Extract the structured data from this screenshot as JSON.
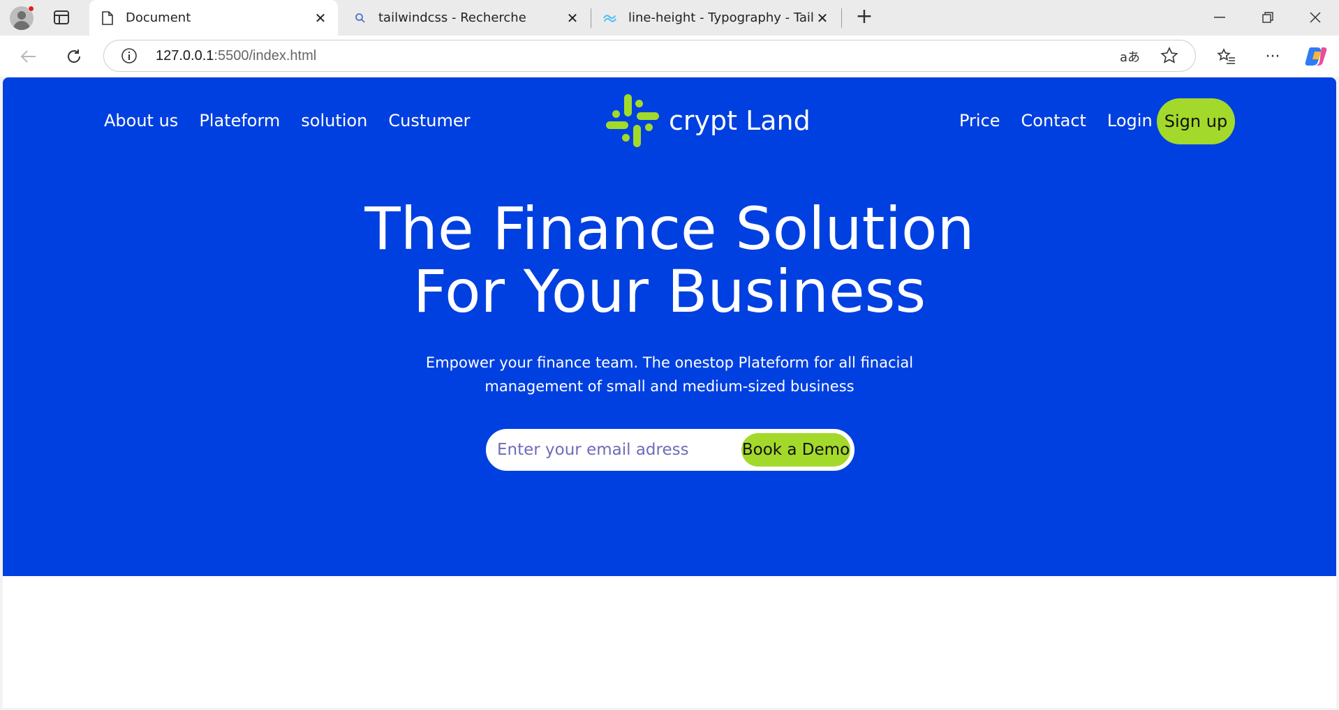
{
  "browser": {
    "tabs": [
      {
        "title": "Document",
        "favicon": "page-icon",
        "active": true
      },
      {
        "title": "tailwindcss - Recherche",
        "favicon": "search-icon",
        "active": false
      },
      {
        "title": "line-height - Typography - Tailwin",
        "favicon": "tailwind-icon",
        "active": false
      }
    ],
    "new_tab_label": "+",
    "address": {
      "host": "127.0.0.1",
      "rest": ":5500/index.html"
    }
  },
  "site": {
    "nav_left": [
      "About us",
      "Plateform",
      "solution",
      "Custumer"
    ],
    "brand_name": "crypt Land",
    "nav_right": [
      "Price",
      "Contact",
      "Login"
    ],
    "signup_label": "Sign up",
    "headline_line1": "The Finance Solution",
    "headline_line2": "For Your Business",
    "subtext_line1": "Empower your finance team. The onestop Plateform for all finacial",
    "subtext_line2": "management of small and medium-sized business",
    "email_placeholder": "Enter your email adress",
    "demo_label": "Book a Demo"
  },
  "colors": {
    "hero_bg": "#0140e0",
    "accent_green": "#a3d92b",
    "text_white": "#ffffff"
  }
}
